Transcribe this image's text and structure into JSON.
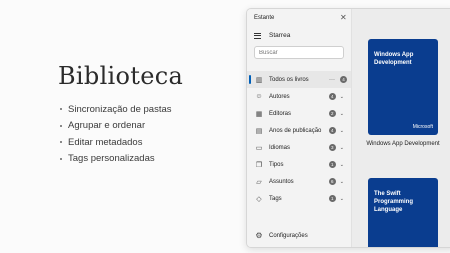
{
  "promo": {
    "title": "Biblioteca",
    "features": [
      "Sincronização de pastas",
      "Agrupar e ordenar",
      "Editar metadados",
      "Tags personalizadas"
    ]
  },
  "window": {
    "title": "Estante",
    "app_name": "Starrea",
    "search_placeholder": "Buscar",
    "nav": [
      {
        "label": "Todos os livros",
        "count": "4",
        "icon": "library-icon"
      },
      {
        "label": "Autores",
        "count": "4",
        "icon": "person-icon"
      },
      {
        "label": "Editoras",
        "count": "2",
        "icon": "building-icon"
      },
      {
        "label": "Anos de publicação",
        "count": "4",
        "icon": "calendar-icon"
      },
      {
        "label": "Idiomas",
        "count": "3",
        "icon": "chat-icon"
      },
      {
        "label": "Tipos",
        "count": "1",
        "icon": "copy-icon"
      },
      {
        "label": "Assuntos",
        "count": "6",
        "icon": "folder-icon"
      },
      {
        "label": "Tags",
        "count": "1",
        "icon": "tag-icon"
      }
    ],
    "settings_label": "Configurações"
  },
  "books": [
    {
      "cover_title": "Windows App Development",
      "publisher": "Microsoft",
      "caption": "Windows App Development"
    },
    {
      "cover_title": "The Swift Programming Language"
    }
  ],
  "colors": {
    "cover": "#0a3d8f",
    "accent": "#005fb8"
  }
}
